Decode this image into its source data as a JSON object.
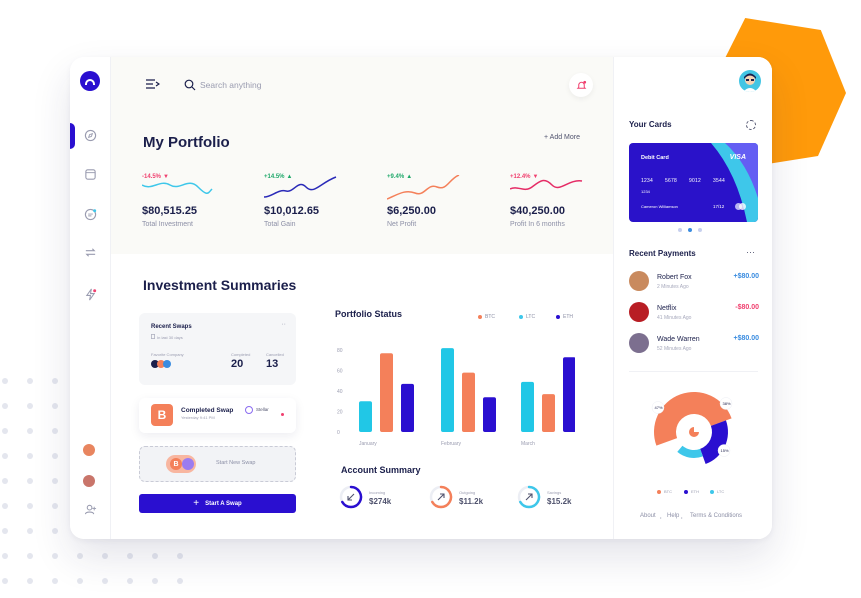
{
  "header": {
    "search_placeholder": "Search anything"
  },
  "portfolio": {
    "title": "My Portfolio",
    "add_more": "+ Add More",
    "stats": [
      {
        "change": "-14.5%",
        "direction": "down",
        "value": "$80,515.25",
        "label": "Total Investment",
        "color": "#3ec7ea"
      },
      {
        "change": "+14.5%",
        "direction": "up",
        "value": "$10,012.65",
        "label": "Total Gain",
        "color": "#2a2ab8"
      },
      {
        "change": "+9.4%",
        "direction": "up",
        "value": "$6,250.00",
        "label": "Net Profit",
        "color": "#f4805a"
      },
      {
        "change": "+12.4%",
        "direction": "down",
        "value": "$40,250.00",
        "label": "Profit In 6 months",
        "color": "#e52c66"
      }
    ]
  },
  "summaries": {
    "title": "Investment Summaries",
    "recent_swaps": {
      "title": "Recent Swaps",
      "subtitle": "In last 30 days",
      "more": "··",
      "favorite_label": "Favorite Company",
      "completed_label": "Completed",
      "completed_value": "20",
      "cancelled_label": "Cancelled",
      "cancelled_value": "13"
    },
    "completed_swap": {
      "title": "Completed Swap",
      "when": "Yesterday 9:41 PM",
      "tag": "Stellar",
      "icon": "B"
    },
    "start_new_swap": "Start New Swap",
    "start_button": "Start A Swap"
  },
  "portfolio_status": {
    "title": "Portfolio Status",
    "legend": [
      {
        "name": "BTC",
        "color": "#f4805a"
      },
      {
        "name": "LTC",
        "color": "#3ec7ea"
      },
      {
        "name": "ETH",
        "color": "#2a0fd0"
      }
    ]
  },
  "chart_data": {
    "type": "bar",
    "categories": [
      "January",
      "February",
      "March"
    ],
    "series": [
      {
        "name": "LTC",
        "values": [
          30,
          82,
          49
        ]
      },
      {
        "name": "BTC",
        "values": [
          77,
          58,
          37
        ]
      },
      {
        "name": "ETH",
        "values": [
          47,
          34,
          73
        ]
      }
    ],
    "yticks": [
      "0",
      "20",
      "40",
      "60",
      "80"
    ],
    "ylim": [
      0,
      85
    ],
    "colors": {
      "LTC": "#21c7e6",
      "BTC": "#f4805a",
      "ETH": "#2a0fd0"
    }
  },
  "account_summary": {
    "title": "Account Summary",
    "items": [
      {
        "label": "Incoming",
        "amount": "$274k",
        "color": "#2a0fd0",
        "icon": "arrow-down-left-icon"
      },
      {
        "label": "Outgoing",
        "amount": "$11.2k",
        "color": "#f4805a",
        "icon": "arrow-up-right-icon"
      },
      {
        "label": "Savings",
        "amount": "$15.2k",
        "color": "#3ec7ea",
        "icon": "arrow-up-right-icon"
      }
    ]
  },
  "cards": {
    "title": "Your Cards",
    "card": {
      "type": "Debit Card",
      "brand": "VISA",
      "number_groups": [
        "1234",
        "5678",
        "9012",
        "3544"
      ],
      "number_line2": "1234",
      "holder": "Cameron Williamson",
      "expiry": "17/12"
    }
  },
  "payments": {
    "title": "Recent Payments",
    "more": "···",
    "items": [
      {
        "name": "Robert Fox",
        "time": "2 Minutes Ago",
        "amount": "+$80.00",
        "color": "#3a8ce0"
      },
      {
        "name": "Netflix",
        "time": "41 Minutes Ago",
        "amount": "-$80.00",
        "color": "#f0406f"
      },
      {
        "name": "Wade Warren",
        "time": "52 Minutes Ago",
        "amount": "+$80.00",
        "color": "#3a8ce0"
      }
    ]
  },
  "allocation": {
    "segments": [
      {
        "name": "BTC",
        "percent": "47%",
        "color": "#f4805a"
      },
      {
        "name": "ETH",
        "percent": "38%",
        "color": "#2a0fd0"
      },
      {
        "name": "LTC",
        "percent": "15%",
        "color": "#3ec7ea"
      }
    ]
  },
  "footer": {
    "about": "About",
    "help": "Help",
    "terms": "Terms & Conditions",
    "sep": "•"
  }
}
